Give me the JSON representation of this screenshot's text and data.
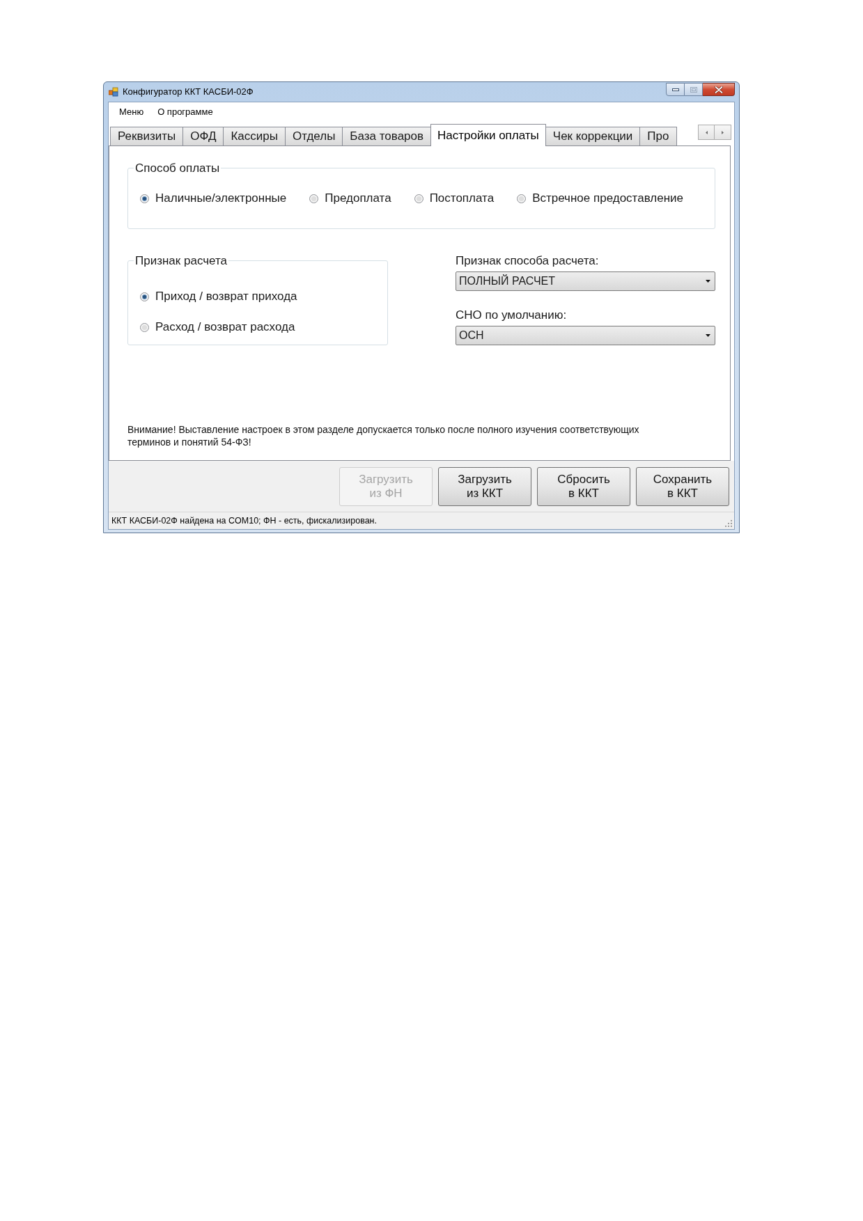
{
  "window": {
    "title": "Конфигуратор ККТ КАСБИ-02Ф"
  },
  "menu": [
    {
      "label": "Меню"
    },
    {
      "label": "О программе"
    }
  ],
  "tabs": [
    {
      "label": "Реквизиты",
      "selected": false
    },
    {
      "label": "ОФД",
      "selected": false
    },
    {
      "label": "Кассиры",
      "selected": false
    },
    {
      "label": "Отделы",
      "selected": false
    },
    {
      "label": "База товаров",
      "selected": false
    },
    {
      "label": "Настройки оплаты",
      "selected": true
    },
    {
      "label": "Чек коррекции",
      "selected": false
    },
    {
      "label": "Про",
      "selected": false
    }
  ],
  "payment_method": {
    "title": "Способ оплаты",
    "options": [
      {
        "label": "Наличные/электронные",
        "selected": true
      },
      {
        "label": "Предоплата",
        "selected": false
      },
      {
        "label": "Постоплата",
        "selected": false
      },
      {
        "label": "Встречное предоставление",
        "selected": false
      }
    ]
  },
  "settlement_sign": {
    "title": "Признак расчета",
    "options": [
      {
        "label": "Приход / возврат прихода",
        "selected": true
      },
      {
        "label": "Расход / возврат расхода",
        "selected": false
      }
    ]
  },
  "dropdowns": [
    {
      "label": "Признак способа расчета:",
      "value": "ПОЛНЫЙ РАСЧЕТ"
    },
    {
      "label": "СНО по умолчанию:",
      "value": "ОСН"
    }
  ],
  "warning": "Внимание! Выставление настроек в этом разделе допускается только после полного изучения соответствующих терминов и понятий 54-ФЗ!",
  "buttons": [
    {
      "label": "Загрузить\nиз ФН",
      "disabled": true
    },
    {
      "label": "Загрузить\nиз ККТ",
      "disabled": false
    },
    {
      "label": "Сбросить\nв ККТ",
      "disabled": false
    },
    {
      "label": "Сохранить\nв ККТ",
      "disabled": false
    }
  ],
  "status_bar": "ККТ КАСБИ-02Ф найдена на COM10; ФН - есть, фискализирован."
}
